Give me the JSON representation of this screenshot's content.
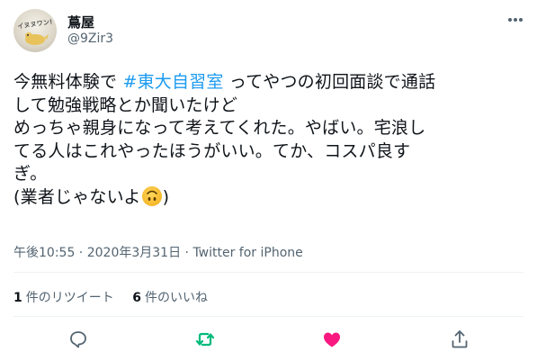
{
  "author": {
    "name": "蔦屋",
    "handle": "@9Zir3",
    "avatar_text": "イヌヌワン!"
  },
  "tweet": {
    "line1_before": "今無料体験で ",
    "hashtag": "#東大自習室",
    "line1_after": " ってやつの初回面談で通話",
    "line2": "して勉強戦略とか聞いたけど",
    "line3": "めっちゃ親身になって考えてくれた。やばい。宅浪し",
    "line4": "てる人はこれやったほうがいい。てか、コスパ良す",
    "line5": "ぎ。",
    "line6_before": "(業者じゃないよ",
    "line6_after": ")",
    "emoji": "upside-down-face"
  },
  "meta": {
    "time": "午後10:55",
    "separator1": " · ",
    "date": "2020年3月31日",
    "separator2": " · ",
    "source": "Twitter for iPhone"
  },
  "stats": {
    "retweets_count": "1",
    "retweets_label": "件のリツイート",
    "likes_count": "6",
    "likes_label": "件のいいね"
  },
  "icons": {
    "reply": "reply-icon",
    "retweet": "retweet-icon",
    "like": "heart-icon",
    "share": "share-icon",
    "more": "more-icon"
  },
  "colors": {
    "hashtag": "#1d9bf0",
    "retweet_active": "#00ba7c",
    "like_active": "#f91880",
    "secondary_text": "#536471"
  }
}
